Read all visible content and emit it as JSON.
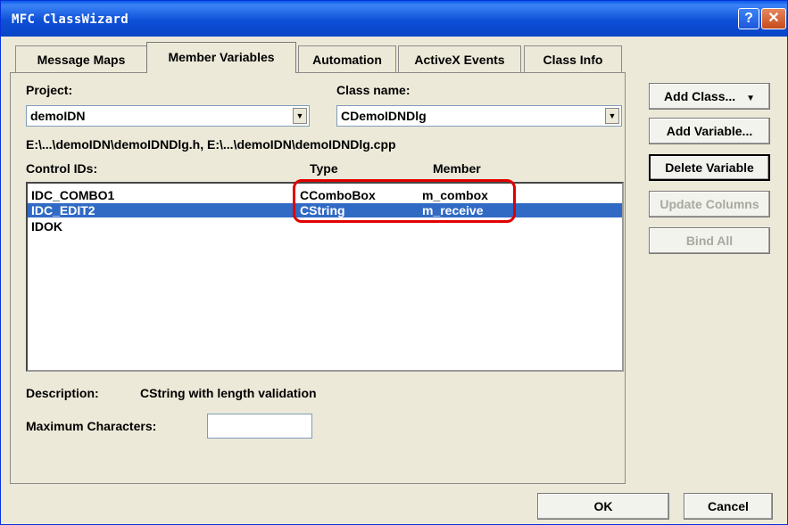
{
  "window": {
    "title": "MFC ClassWizard",
    "help_glyph": "?",
    "close_glyph": "✕"
  },
  "tabs": [
    {
      "label": "Message Maps",
      "active": false
    },
    {
      "label": "Member Variables",
      "active": true
    },
    {
      "label": "Automation",
      "active": false
    },
    {
      "label": "ActiveX Events",
      "active": false
    },
    {
      "label": "Class Info",
      "active": false
    }
  ],
  "project": {
    "label": "Project:",
    "value": "demoIDN"
  },
  "class_name": {
    "label": "Class name:",
    "value": "CDemoIDNDlg"
  },
  "path_text": "E:\\...\\demoIDN\\demoIDNDlg.h, E:\\...\\demoIDN\\demoIDNDlg.cpp",
  "list": {
    "columns": {
      "ids": "Control IDs:",
      "type": "Type",
      "member": "Member"
    },
    "rows": [
      {
        "id": "IDC_COMBO1",
        "type": "CComboBox",
        "member": "m_combox",
        "selected": false
      },
      {
        "id": "IDC_EDIT2",
        "type": "CString",
        "member": "m_receive",
        "selected": true
      },
      {
        "id": "IDOK",
        "type": "",
        "member": "",
        "selected": false
      }
    ]
  },
  "description": {
    "label": "Description:",
    "value": "CString with length validation"
  },
  "max_chars": {
    "label": "Maximum Characters:",
    "value": ""
  },
  "buttons": {
    "add_class": "Add Class...",
    "add_variable": "Add Variable...",
    "delete_variable": "Delete Variable",
    "update_columns": "Update Columns",
    "bind_all": "Bind All",
    "ok": "OK",
    "cancel": "Cancel"
  },
  "colors": {
    "selection": "#316ac5",
    "annotation": "#e00000",
    "titlebar": "#0a5ae8"
  }
}
